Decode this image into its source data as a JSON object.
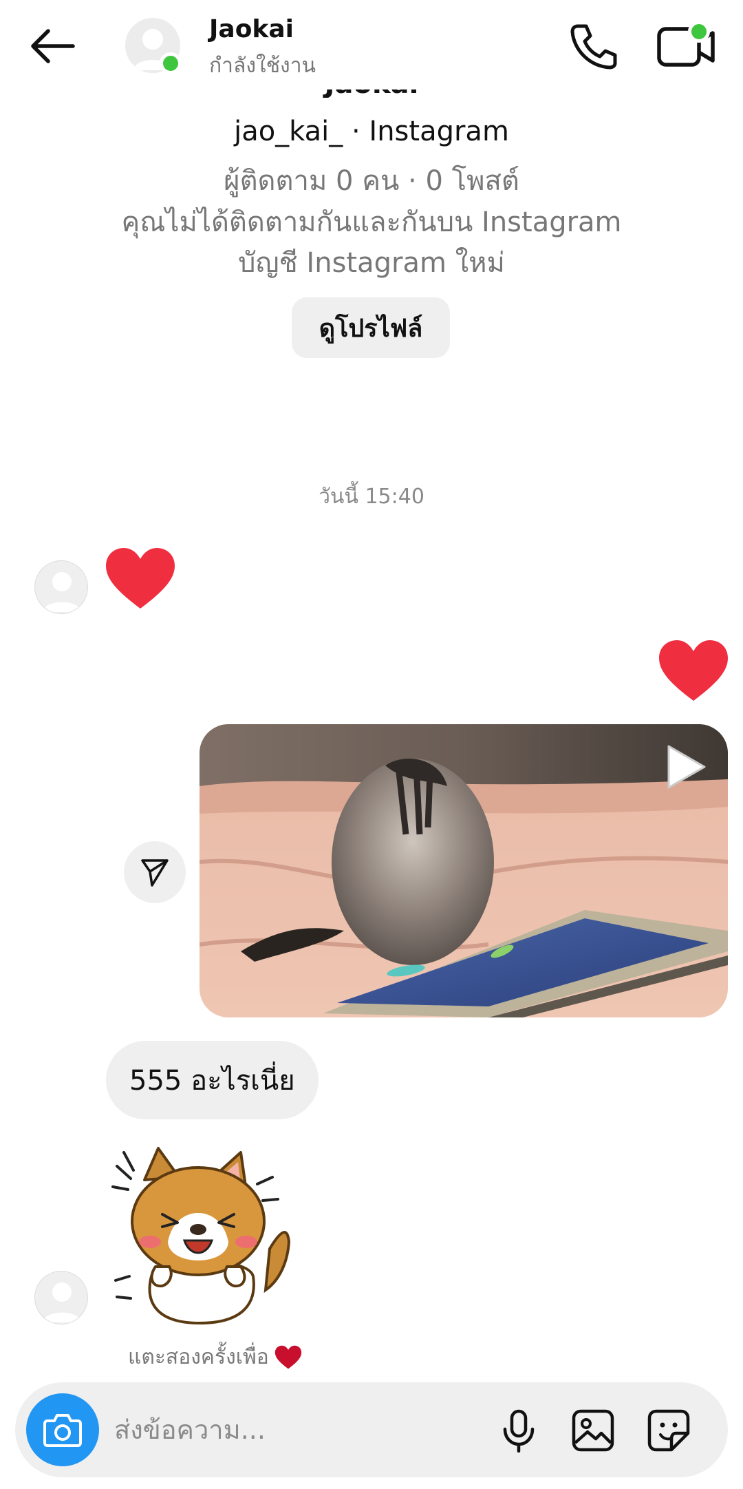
{
  "header": {
    "name": "Jaokai",
    "status": "กำลังใช้งาน"
  },
  "profile": {
    "display_name": "Jaokai",
    "handle_line": "jao_kai_ · Instagram",
    "stats_line": "ผู้ติดตาม 0 คน · 0 โพสต์",
    "follow_line": "คุณไม่ได้ติดตามกันและกันบน Instagram",
    "new_account_line": "บัญชี Instagram ใหม่",
    "view_profile_label": "ดูโปรไฟล์"
  },
  "conversation": {
    "timestamp": "วันนี้ 15:40",
    "text_message": "555 อะไรเนี่ย",
    "double_tap_hint": "แตะสองครั้งเพื่อ"
  },
  "composer": {
    "placeholder": "ส่งข้อความ..."
  },
  "colors": {
    "online": "#3ec73e",
    "heart": "#ef2f40",
    "camera_button": "#2196f3",
    "bubble": "#efefef"
  },
  "icons": [
    "back-arrow-icon",
    "phone-icon",
    "video-call-icon",
    "heart-icon",
    "send-icon",
    "play-icon",
    "camera-icon",
    "microphone-icon",
    "gallery-icon",
    "sticker-icon"
  ]
}
